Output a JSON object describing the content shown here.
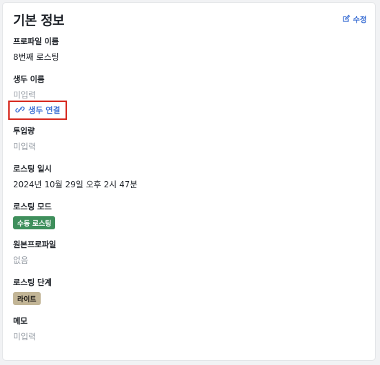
{
  "card": {
    "title": "기본 정보",
    "edit_label": "수정"
  },
  "fields": {
    "profile_name": {
      "label": "프로파일 이름",
      "value": "8번째 로스팅"
    },
    "bean_name": {
      "label": "생두 이름",
      "value": "미입력",
      "link_label": "생두 연결"
    },
    "input_amount": {
      "label": "투입량",
      "value": "미입력"
    },
    "roast_datetime": {
      "label": "로스팅 일시",
      "value": "2024년 10월 29일 오후 2시 47분"
    },
    "roast_mode": {
      "label": "로스팅 모드",
      "badge": "수동 로스팅"
    },
    "source_profile": {
      "label": "원본프로파일",
      "value": "없음"
    },
    "roast_level": {
      "label": "로스팅 단계",
      "badge": "라이트"
    },
    "memo": {
      "label": "메모",
      "value": "미입력"
    }
  },
  "colors": {
    "accent": "#3b6fd4",
    "highlight_border": "#d6251b",
    "mode_badge": "#3f8f5c",
    "level_badge": "#c2b596",
    "muted_text": "#9aa0a8"
  },
  "icons": {
    "edit": "pencil-square-icon",
    "link": "chain-link-icon"
  }
}
